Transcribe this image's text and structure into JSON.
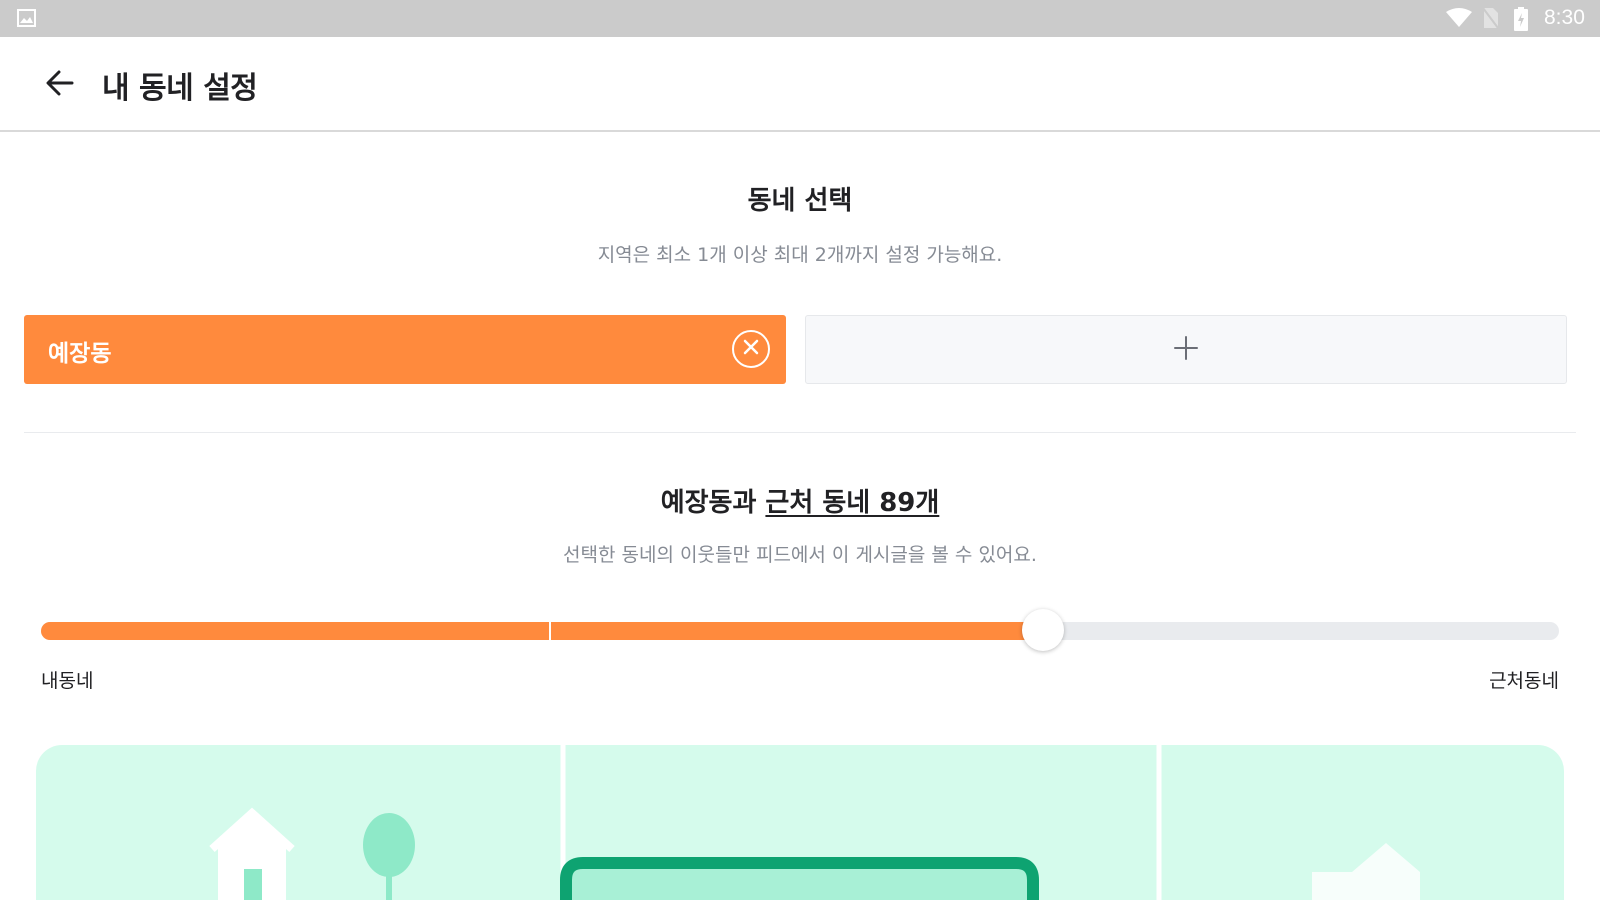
{
  "status_bar": {
    "time": "8:30",
    "icons": [
      "gallery-icon",
      "wifi-icon",
      "no-sim-icon",
      "battery-charging-icon"
    ]
  },
  "app_bar": {
    "back_icon": "arrow-left-icon",
    "title": "내 동네 설정"
  },
  "area_section": {
    "title": "동네 선택",
    "subtitle": "지역은 최소 1개 이상 최대 2개까지 설정 가능해요.",
    "selected_area": "예장동",
    "remove_icon": "close-circle-icon",
    "add_icon": "plus-icon"
  },
  "range_section": {
    "title_prefix": "예장동과 ",
    "title_link": "근처 동네 89개",
    "subtitle": "선택한 동네의 이웃들만 피드에서 이 게시글을 볼 수 있어요.",
    "min_label": "내동네",
    "max_label": "근처동네",
    "level": 0.66
  },
  "colors": {
    "accent": "#ff8a3d",
    "illustration_bg": "#d5fbec",
    "illustration_green": "#0ea371"
  }
}
